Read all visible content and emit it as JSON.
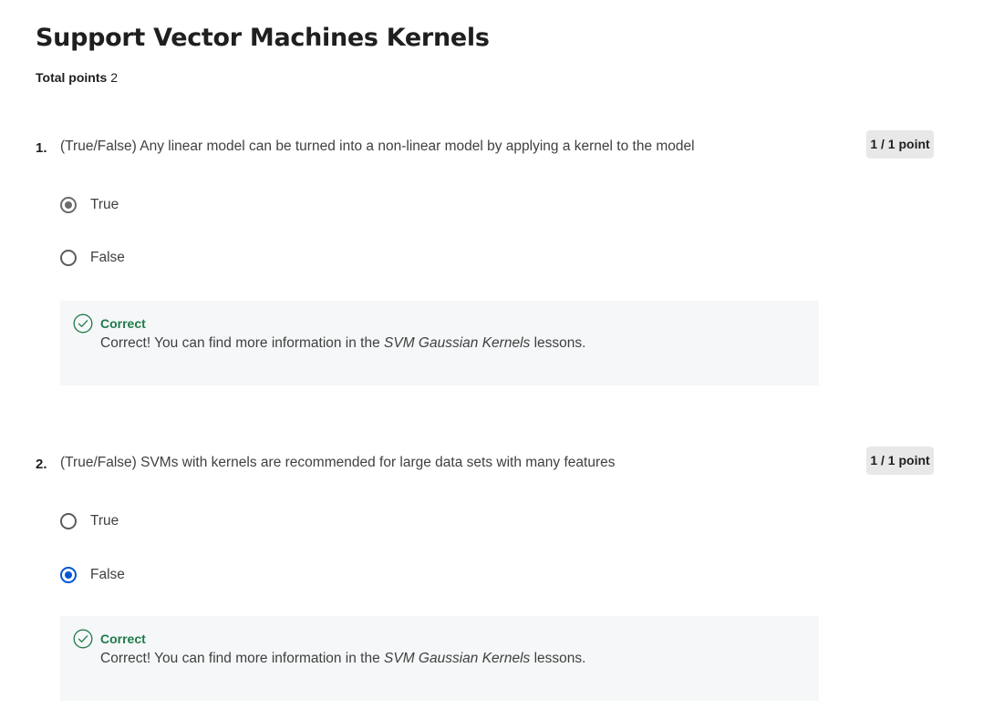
{
  "page": {
    "title": "Support Vector Machines Kernels",
    "total_points_label": "Total points",
    "total_points_value": "2"
  },
  "questions": [
    {
      "number": "1.",
      "text": "(True/False) Any linear model can be turned into a non-linear model by applying a kernel to the model",
      "points": "1 / 1 point",
      "options": [
        {
          "label": "True",
          "selected": true
        },
        {
          "label": "False",
          "selected": false
        }
      ],
      "feedback": {
        "status": "Correct",
        "text_before": "Correct! You can find more information in the ",
        "text_italic": "SVM Gaussian Kernels",
        "text_after": " lessons.",
        "icon": "check-circle-icon"
      }
    },
    {
      "number": "2.",
      "text": "(True/False) SVMs with kernels are recommended for large data sets with many features",
      "points": "1 / 1 point",
      "options": [
        {
          "label": "True",
          "selected": false
        },
        {
          "label": "False",
          "selected": true
        }
      ],
      "feedback": {
        "status": "Correct",
        "text_before": "Correct! You can find more information in the ",
        "text_italic": "SVM Gaussian Kernels",
        "text_after": " lessons.",
        "icon": "check-circle-icon"
      }
    }
  ],
  "colors": {
    "correct_green": "#1f7a4a",
    "selected_blue": "#0056d2",
    "feedback_bg": "#f5f7f8",
    "badge_bg": "#e8e8e8"
  }
}
